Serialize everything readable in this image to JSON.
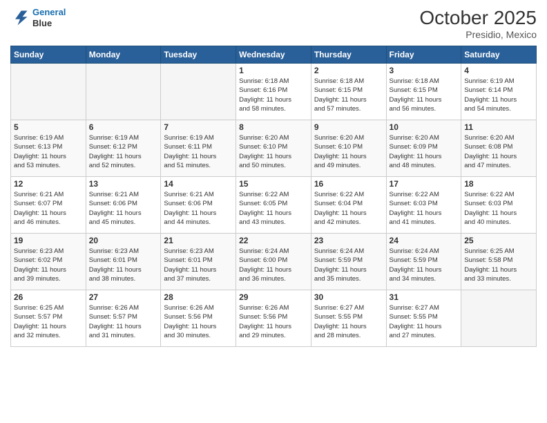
{
  "header": {
    "logo_line1": "General",
    "logo_line2": "Blue",
    "month": "October 2025",
    "location": "Presidio, Mexico"
  },
  "days_of_week": [
    "Sunday",
    "Monday",
    "Tuesday",
    "Wednesday",
    "Thursday",
    "Friday",
    "Saturday"
  ],
  "weeks": [
    [
      {
        "day": "",
        "info": ""
      },
      {
        "day": "",
        "info": ""
      },
      {
        "day": "",
        "info": ""
      },
      {
        "day": "1",
        "info": "Sunrise: 6:18 AM\nSunset: 6:16 PM\nDaylight: 11 hours\nand 58 minutes."
      },
      {
        "day": "2",
        "info": "Sunrise: 6:18 AM\nSunset: 6:15 PM\nDaylight: 11 hours\nand 57 minutes."
      },
      {
        "day": "3",
        "info": "Sunrise: 6:18 AM\nSunset: 6:15 PM\nDaylight: 11 hours\nand 56 minutes."
      },
      {
        "day": "4",
        "info": "Sunrise: 6:19 AM\nSunset: 6:14 PM\nDaylight: 11 hours\nand 54 minutes."
      }
    ],
    [
      {
        "day": "5",
        "info": "Sunrise: 6:19 AM\nSunset: 6:13 PM\nDaylight: 11 hours\nand 53 minutes."
      },
      {
        "day": "6",
        "info": "Sunrise: 6:19 AM\nSunset: 6:12 PM\nDaylight: 11 hours\nand 52 minutes."
      },
      {
        "day": "7",
        "info": "Sunrise: 6:19 AM\nSunset: 6:11 PM\nDaylight: 11 hours\nand 51 minutes."
      },
      {
        "day": "8",
        "info": "Sunrise: 6:20 AM\nSunset: 6:10 PM\nDaylight: 11 hours\nand 50 minutes."
      },
      {
        "day": "9",
        "info": "Sunrise: 6:20 AM\nSunset: 6:10 PM\nDaylight: 11 hours\nand 49 minutes."
      },
      {
        "day": "10",
        "info": "Sunrise: 6:20 AM\nSunset: 6:09 PM\nDaylight: 11 hours\nand 48 minutes."
      },
      {
        "day": "11",
        "info": "Sunrise: 6:20 AM\nSunset: 6:08 PM\nDaylight: 11 hours\nand 47 minutes."
      }
    ],
    [
      {
        "day": "12",
        "info": "Sunrise: 6:21 AM\nSunset: 6:07 PM\nDaylight: 11 hours\nand 46 minutes."
      },
      {
        "day": "13",
        "info": "Sunrise: 6:21 AM\nSunset: 6:06 PM\nDaylight: 11 hours\nand 45 minutes."
      },
      {
        "day": "14",
        "info": "Sunrise: 6:21 AM\nSunset: 6:06 PM\nDaylight: 11 hours\nand 44 minutes."
      },
      {
        "day": "15",
        "info": "Sunrise: 6:22 AM\nSunset: 6:05 PM\nDaylight: 11 hours\nand 43 minutes."
      },
      {
        "day": "16",
        "info": "Sunrise: 6:22 AM\nSunset: 6:04 PM\nDaylight: 11 hours\nand 42 minutes."
      },
      {
        "day": "17",
        "info": "Sunrise: 6:22 AM\nSunset: 6:03 PM\nDaylight: 11 hours\nand 41 minutes."
      },
      {
        "day": "18",
        "info": "Sunrise: 6:22 AM\nSunset: 6:03 PM\nDaylight: 11 hours\nand 40 minutes."
      }
    ],
    [
      {
        "day": "19",
        "info": "Sunrise: 6:23 AM\nSunset: 6:02 PM\nDaylight: 11 hours\nand 39 minutes."
      },
      {
        "day": "20",
        "info": "Sunrise: 6:23 AM\nSunset: 6:01 PM\nDaylight: 11 hours\nand 38 minutes."
      },
      {
        "day": "21",
        "info": "Sunrise: 6:23 AM\nSunset: 6:01 PM\nDaylight: 11 hours\nand 37 minutes."
      },
      {
        "day": "22",
        "info": "Sunrise: 6:24 AM\nSunset: 6:00 PM\nDaylight: 11 hours\nand 36 minutes."
      },
      {
        "day": "23",
        "info": "Sunrise: 6:24 AM\nSunset: 5:59 PM\nDaylight: 11 hours\nand 35 minutes."
      },
      {
        "day": "24",
        "info": "Sunrise: 6:24 AM\nSunset: 5:59 PM\nDaylight: 11 hours\nand 34 minutes."
      },
      {
        "day": "25",
        "info": "Sunrise: 6:25 AM\nSunset: 5:58 PM\nDaylight: 11 hours\nand 33 minutes."
      }
    ],
    [
      {
        "day": "26",
        "info": "Sunrise: 6:25 AM\nSunset: 5:57 PM\nDaylight: 11 hours\nand 32 minutes."
      },
      {
        "day": "27",
        "info": "Sunrise: 6:26 AM\nSunset: 5:57 PM\nDaylight: 11 hours\nand 31 minutes."
      },
      {
        "day": "28",
        "info": "Sunrise: 6:26 AM\nSunset: 5:56 PM\nDaylight: 11 hours\nand 30 minutes."
      },
      {
        "day": "29",
        "info": "Sunrise: 6:26 AM\nSunset: 5:56 PM\nDaylight: 11 hours\nand 29 minutes."
      },
      {
        "day": "30",
        "info": "Sunrise: 6:27 AM\nSunset: 5:55 PM\nDaylight: 11 hours\nand 28 minutes."
      },
      {
        "day": "31",
        "info": "Sunrise: 6:27 AM\nSunset: 5:55 PM\nDaylight: 11 hours\nand 27 minutes."
      },
      {
        "day": "",
        "info": ""
      }
    ]
  ]
}
